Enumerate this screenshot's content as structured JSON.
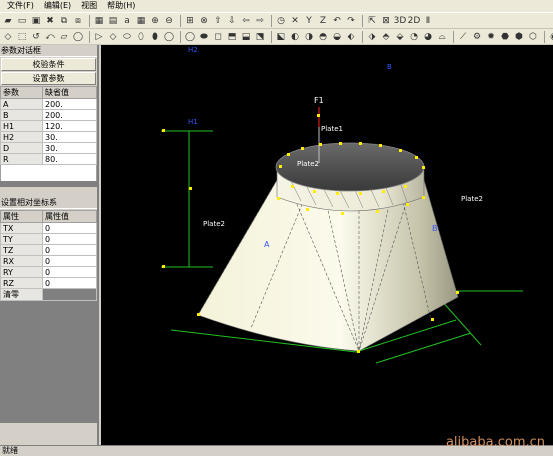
{
  "menu": [
    "文件(F)",
    "编辑(E)",
    "视图",
    "帮助(H)"
  ],
  "toolbar1": [
    "folder-open-icon",
    "new-file-icon",
    "save-icon",
    "delete-icon",
    "copy-icon",
    "paste-icon",
    "grid-icon",
    "print-icon",
    "text-icon",
    "grid2-icon",
    "zoom-in-icon",
    "zoom-out-icon",
    "zoom-window-icon",
    "pan-icon",
    "arrow-up-icon",
    "arrow-down-icon",
    "arrow-left-icon",
    "arrow-right-icon",
    "clock-icon",
    "axis-x-icon",
    "axis-y-icon",
    "axis-z-icon",
    "undo-icon",
    "redo-icon",
    "pointer-icon",
    "mirror-icon",
    "3d-icon",
    "2d-icon",
    "unit-icon"
  ],
  "toolbar1_glyphs": [
    "▰",
    "▭",
    "▣",
    "✖",
    "⧉",
    "⧈",
    "▦",
    "▤",
    "a",
    "▦",
    "⊕",
    "⊖",
    "⊞",
    "⊗",
    "⇧",
    "⇩",
    "⇦",
    "⇨",
    "◷",
    "✕",
    "Y",
    "Z",
    "↶",
    "↷",
    "⇱",
    "⊠",
    "3D",
    "2D",
    "Ⅱ"
  ],
  "toolbar2_glyphs": [
    "◇",
    "⬚",
    "↺",
    "⤺",
    "▱",
    "◯",
    "▷",
    "◇",
    "⬭",
    "⬯",
    "⬮",
    "◯",
    "◯",
    "⬬",
    "◻",
    "⬒",
    "⬓",
    "⬔",
    "⬕",
    "◐",
    "◑",
    "◓",
    "◒",
    "⬖",
    "⬗",
    "⬘",
    "⬙",
    "◔",
    "◕",
    "⌓",
    "⟋",
    "⚙",
    "✹",
    "⬣",
    "⬢",
    "⬡",
    "◉",
    "⊕"
  ],
  "param_panel": {
    "title": "参数对话框",
    "check_button": "校验条件",
    "set_button": "设置参数",
    "headers": [
      "参数",
      "缺省值"
    ],
    "rows": [
      [
        "A",
        "200."
      ],
      [
        "B",
        "200."
      ],
      [
        "H1",
        "120."
      ],
      [
        "H2",
        "30."
      ],
      [
        "D",
        "30."
      ],
      [
        "R",
        "80."
      ]
    ]
  },
  "coord_panel": {
    "title": "设置相对坐标系",
    "headers": [
      "属性",
      "属性值"
    ],
    "rows": [
      [
        "TX",
        "0"
      ],
      [
        "TY",
        "0"
      ],
      [
        "TZ",
        "0"
      ],
      [
        "RX",
        "0"
      ],
      [
        "RY",
        "0"
      ],
      [
        "RZ",
        "0"
      ],
      [
        "清零",
        ""
      ]
    ]
  },
  "viewport": {
    "labels": {
      "f1": "F1",
      "plate1": "Plate1",
      "plate2_top": "Plate2",
      "plate2_right": "Plate2",
      "plate2_left": "Plate2",
      "h1": "H1",
      "h2": "H2",
      "a": "A",
      "b": "B",
      "b_top": "B"
    },
    "colors": {
      "background": "#000000",
      "surface": "#f4f2d8",
      "dimension": "#22c022",
      "blue_label": "#3355ff",
      "point": "#ffee00"
    }
  },
  "status": "就绪",
  "watermark": "alibaba.com.cn"
}
